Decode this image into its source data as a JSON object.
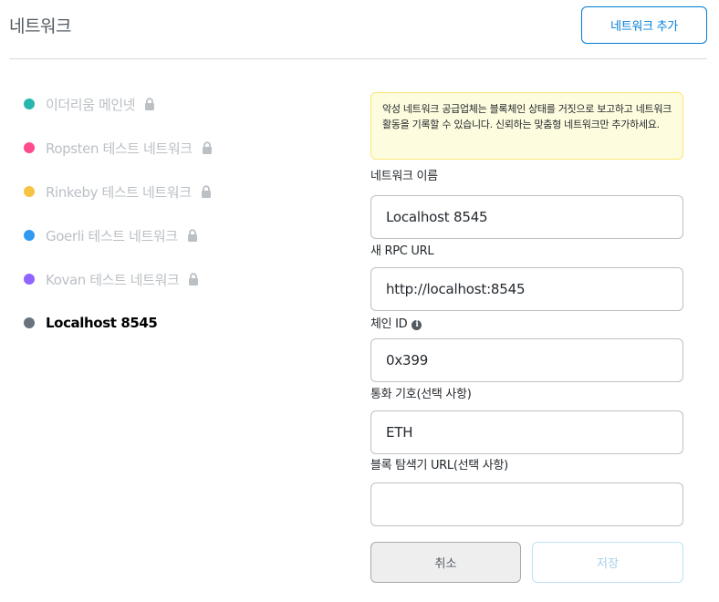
{
  "header": {
    "title": "네트워크",
    "add_button_label": "네트워크 추가"
  },
  "networks": [
    {
      "label": "이더리움 메인넷",
      "color": "#29b6af",
      "locked": true,
      "selected": false
    },
    {
      "label": "Ropsten 테스트 네트워크",
      "color": "#ff4a8d",
      "locked": true,
      "selected": false
    },
    {
      "label": "Rinkeby 테스트 네트워크",
      "color": "#f6c343",
      "locked": true,
      "selected": false
    },
    {
      "label": "Goerli 테스트 네트워크",
      "color": "#3099f2",
      "locked": true,
      "selected": false
    },
    {
      "label": "Kovan 테스트 네트워크",
      "color": "#9064ff",
      "locked": true,
      "selected": false
    },
    {
      "label": "Localhost 8545",
      "color": "#6a737d",
      "locked": false,
      "selected": true
    }
  ],
  "form": {
    "warning": "악성 네트워크 공급업체는 블록체인 상태를 거짓으로 보고하고 네트워크 활동을 기록할 수 있습니다. 신뢰하는 맞춤형 네트워크만 추가하세요.",
    "network_name_label": "네트워크 이름",
    "network_name_value": "Localhost 8545",
    "rpc_url_label": "새 RPC URL",
    "rpc_url_value": "http://localhost:8545",
    "chain_id_label": "체인 ID",
    "chain_id_value": "0x399",
    "currency_label": "통화 기호(선택 사항)",
    "currency_value": "ETH",
    "explorer_label": "블록 탐색기 URL(선택 사항)",
    "explorer_value": "",
    "cancel_label": "취소",
    "save_label": "저장"
  },
  "icons": {
    "lock": "lock-icon",
    "info": "info-icon"
  }
}
